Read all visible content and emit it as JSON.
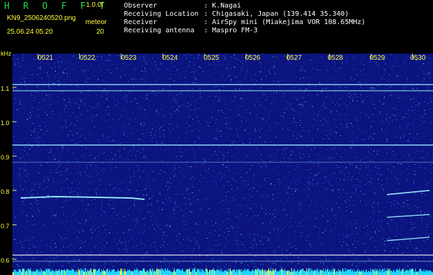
{
  "header": {
    "app_title": "H R O F F T",
    "version": "1.0.0f",
    "filename": "KN9_2506240520.png",
    "datetime": "25.06.24 05:20",
    "meteor_label": "meteor",
    "meteor_count": "20",
    "info": [
      {
        "label": "Observer",
        "value": ": K.Nagai"
      },
      {
        "label": "Receiving Location",
        "value": ": Chigasaki, Japan (139.414 35.340)"
      },
      {
        "label": "Receiver",
        "value": ": AirSpy mini (Miakejima VOR 108.65MHz)"
      },
      {
        "label": "Receiving antenna",
        "value": ": Maspro FM-3"
      }
    ]
  },
  "y_axis": {
    "unit": "kHz",
    "ticks": [
      "1.1",
      "1.0",
      "0.9",
      "0.8",
      "0.7",
      "0.6"
    ]
  },
  "x_axis": {
    "ticks": [
      "0521",
      "0522",
      "0523",
      "0524",
      "0525",
      "0526",
      "0527",
      "0528",
      "0529",
      "0530"
    ]
  },
  "colors": {
    "background": "#0b147f",
    "noise": "#3fa8ff",
    "carrier": "#9ef2ff",
    "label": "#ffff3c",
    "title": "#1fdc4a",
    "floor": "#21d6ff"
  }
}
